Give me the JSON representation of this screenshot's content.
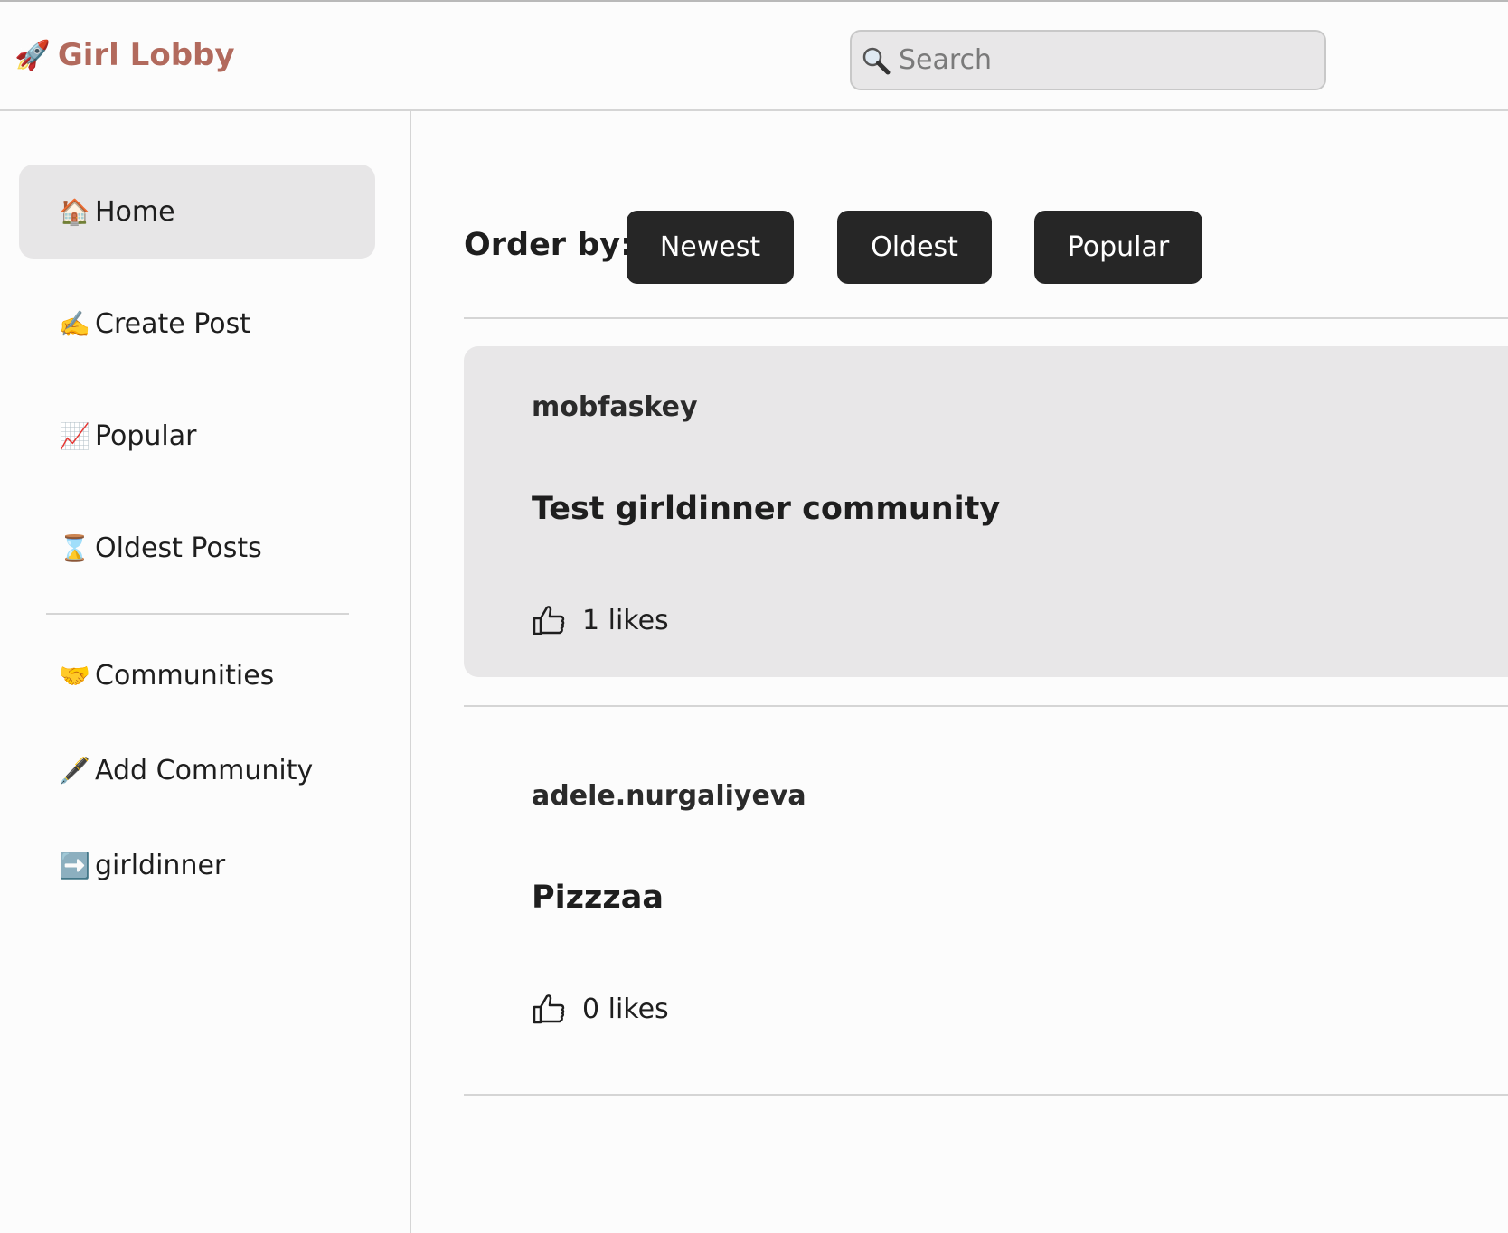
{
  "header": {
    "brand_icon": "🚀",
    "brand_title": "Girl Lobby",
    "search_placeholder": "Search"
  },
  "sidebar": {
    "items": [
      {
        "icon": "🏠",
        "label": "Home",
        "active": true
      },
      {
        "icon": "✍️",
        "label": "Create Post"
      },
      {
        "icon": "📈",
        "label": "Popular"
      },
      {
        "icon": "⌛",
        "label": "Oldest Posts"
      },
      {
        "icon": "🤝",
        "label": "Communities"
      },
      {
        "icon": "🖋️",
        "label": "Add Community"
      },
      {
        "icon": "➡️",
        "label": "girldinner"
      }
    ]
  },
  "main": {
    "order_label": "Order by:",
    "order_buttons": [
      "Newest",
      "Oldest",
      "Popular"
    ],
    "posts": [
      {
        "author": "mobfaskey",
        "title": "Test girldinner community",
        "likes": "1 likes"
      },
      {
        "author": "adele.nurgaliyeva",
        "title": "Pizzzaa",
        "likes": "0 likes"
      }
    ]
  },
  "colors": {
    "brand": "#b26a5d",
    "button_bg": "#262626",
    "active_bg": "#e7e6e7"
  }
}
